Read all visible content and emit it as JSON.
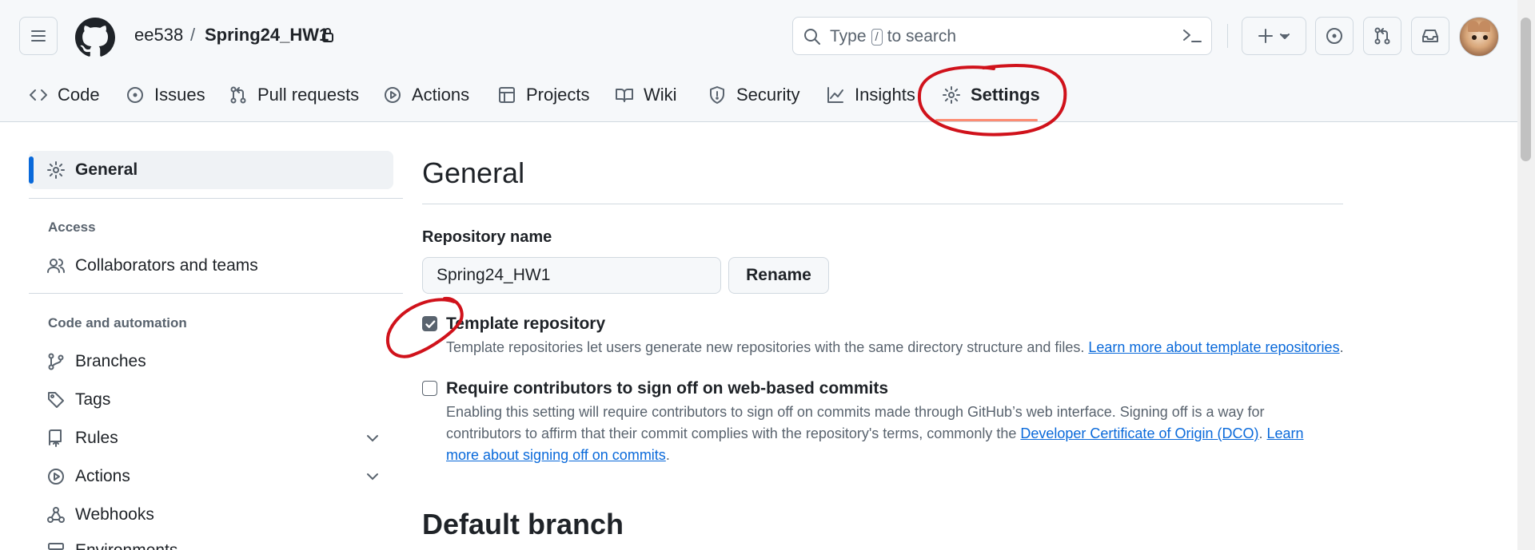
{
  "header": {
    "owner": "ee538",
    "separator": "/",
    "repo": "Spring24_HW1",
    "search_before": "Type",
    "search_key": "/",
    "search_after": "to search"
  },
  "tabs": [
    {
      "label": "Code",
      "icon": "code-icon"
    },
    {
      "label": "Issues",
      "icon": "issue-icon"
    },
    {
      "label": "Pull requests",
      "icon": "pull-request-icon"
    },
    {
      "label": "Actions",
      "icon": "play-icon"
    },
    {
      "label": "Projects",
      "icon": "table-icon"
    },
    {
      "label": "Wiki",
      "icon": "book-icon"
    },
    {
      "label": "Security",
      "icon": "shield-icon"
    },
    {
      "label": "Insights",
      "icon": "graph-icon"
    },
    {
      "label": "Settings",
      "icon": "gear-icon",
      "active": true
    }
  ],
  "sidebar": {
    "general": "General",
    "access_heading": "Access",
    "collaborators": "Collaborators and teams",
    "code_heading": "Code and automation",
    "branches": "Branches",
    "tags": "Tags",
    "rules": "Rules",
    "actions": "Actions",
    "webhooks": "Webhooks",
    "environments": "Environments"
  },
  "main": {
    "title": "General",
    "repo_name_label": "Repository name",
    "repo_name_value": "Spring24_HW1",
    "rename_button": "Rename",
    "template": {
      "checked": true,
      "title": "Template repository",
      "desc": "Template repositories let users generate new repositories with the same directory structure and files.",
      "link": "Learn more about template repositories",
      "end": "."
    },
    "signoff": {
      "checked": false,
      "title": "Require contributors to sign off on web-based commits",
      "desc_line1": "Enabling this setting will require contributors to sign off on commits made through GitHub’s web interface. Signing off is a way for",
      "desc_line2_pre": "contributors to affirm that their commit complies with the repository's terms, commonly the",
      "dco_link": "Developer Certificate of Origin (DCO)",
      "sep": ".",
      "learn1": "Learn",
      "learn2": "more about signing off on commits",
      "end": "."
    },
    "default_branch_title": "Default branch"
  },
  "colors": {
    "accent": "#0969da",
    "tab_underline": "#fd8c73",
    "annotation": "#d0121b"
  }
}
